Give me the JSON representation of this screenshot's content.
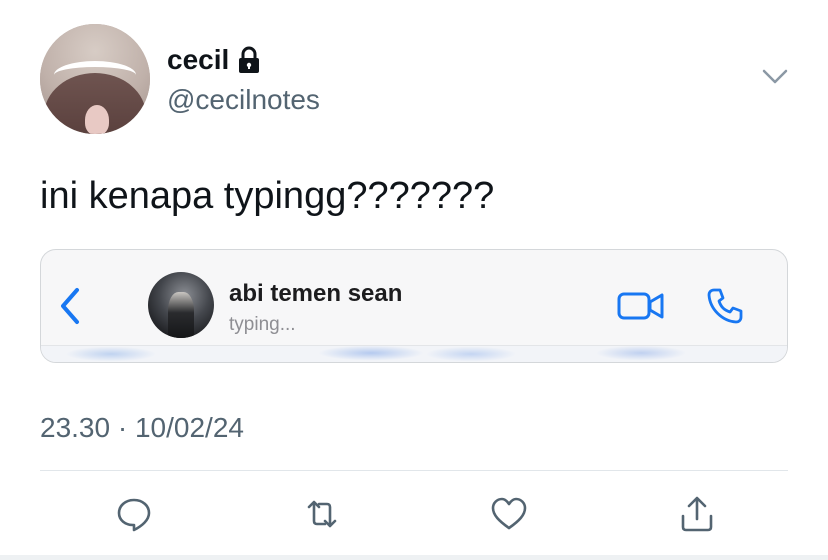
{
  "tweet": {
    "author": {
      "display_name": "cecil",
      "handle": "@cecilnotes",
      "protected": true,
      "lock_icon": "lock-icon"
    },
    "text": "ini kenapa typingg???????",
    "time": "23.30",
    "separator": "·",
    "date": "10/02/24"
  },
  "embedded_screenshot": {
    "contact_name": "abi temen sean",
    "status": "typing...",
    "icons": [
      "back-chevron-icon",
      "video-call-icon",
      "phone-call-icon"
    ],
    "accent_color": "#1877f2"
  },
  "actions": [
    {
      "name": "reply",
      "icon": "reply-icon"
    },
    {
      "name": "retweet",
      "icon": "retweet-icon"
    },
    {
      "name": "like",
      "icon": "heart-icon"
    },
    {
      "name": "share",
      "icon": "share-icon"
    }
  ],
  "colors": {
    "text_primary": "#0f1419",
    "text_secondary": "#536471",
    "divider": "#e1e6ea"
  }
}
